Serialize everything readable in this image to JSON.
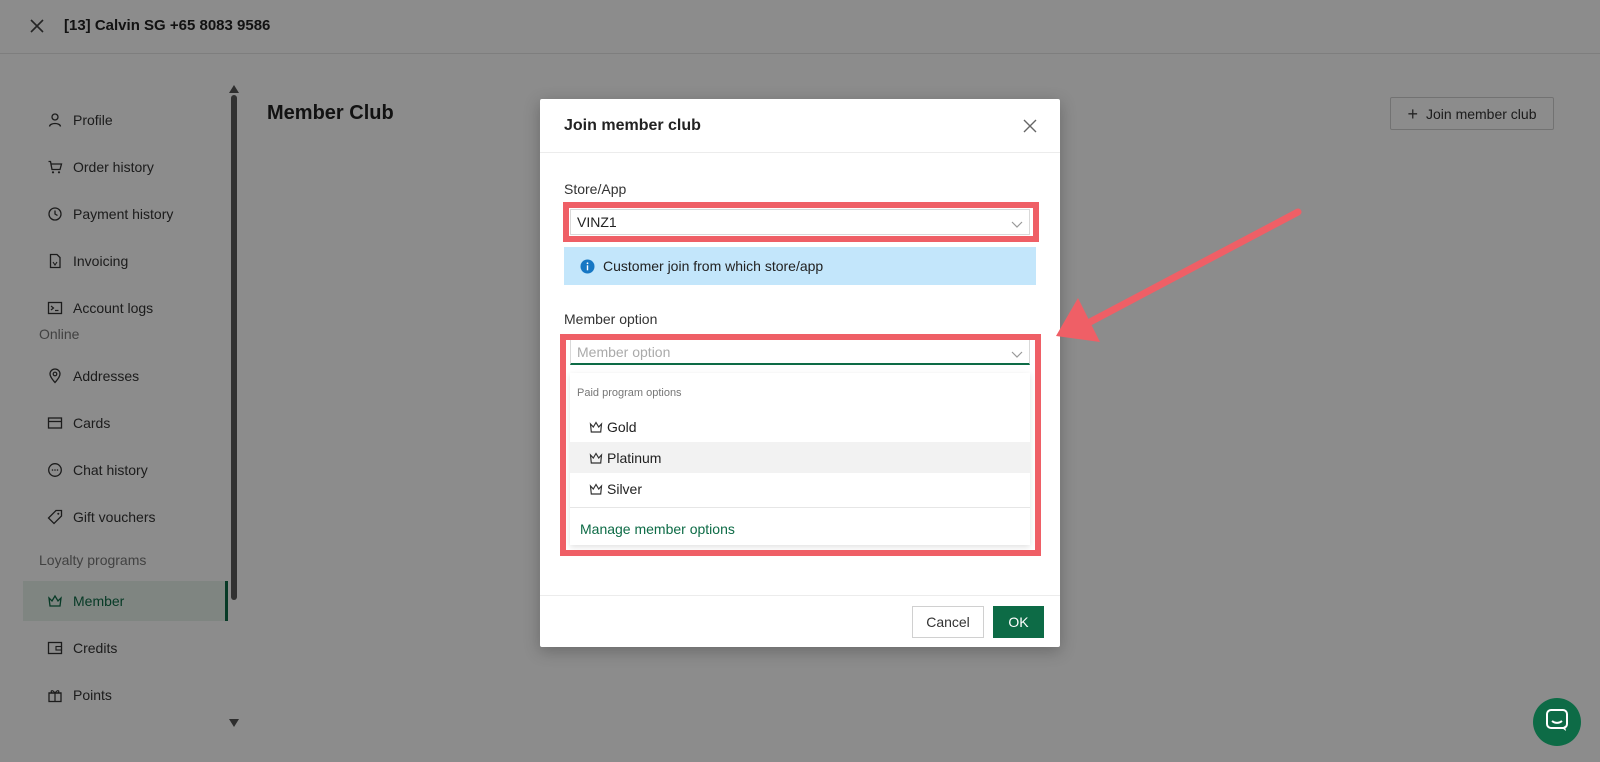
{
  "header": {
    "title": "[13] Calvin SG +65 8083 9586"
  },
  "sidebar": {
    "items": [
      {
        "label": "Profile",
        "icon": "user-icon"
      },
      {
        "label": "Order history",
        "icon": "cart-icon"
      },
      {
        "label": "Payment history",
        "icon": "history-icon"
      },
      {
        "label": "Invoicing",
        "icon": "file-icon"
      },
      {
        "label": "Account logs",
        "icon": "terminal-icon"
      }
    ],
    "section_online": "Online",
    "online_items": [
      {
        "label": "Addresses",
        "icon": "location-icon"
      },
      {
        "label": "Cards",
        "icon": "card-icon"
      },
      {
        "label": "Chat history",
        "icon": "chat-icon"
      },
      {
        "label": "Gift vouchers",
        "icon": "tag-icon"
      }
    ],
    "section_loyalty": "Loyalty programs",
    "loyalty_items": [
      {
        "label": "Member",
        "icon": "crown-icon",
        "active": true
      },
      {
        "label": "Credits",
        "icon": "wallet-icon"
      },
      {
        "label": "Points",
        "icon": "gift-icon"
      }
    ]
  },
  "main": {
    "title": "Member Club",
    "join_button_label": "Join member club"
  },
  "modal": {
    "title": "Join member club",
    "store_label": "Store/App",
    "store_value": "VINZ1",
    "info_text": "Customer join from which store/app",
    "member_label": "Member option",
    "member_placeholder": "Member option",
    "dropdown": {
      "group_label": "Paid program options",
      "options": [
        "Gold",
        "Platinum",
        "Silver"
      ],
      "hovered": "Platinum",
      "manage_label": "Manage member options"
    },
    "cancel_label": "Cancel",
    "ok_label": "OK"
  },
  "colors": {
    "brand_green": "#0d6b46",
    "highlight_red": "#ef5f66",
    "info_blue": "#c3e6fb"
  }
}
